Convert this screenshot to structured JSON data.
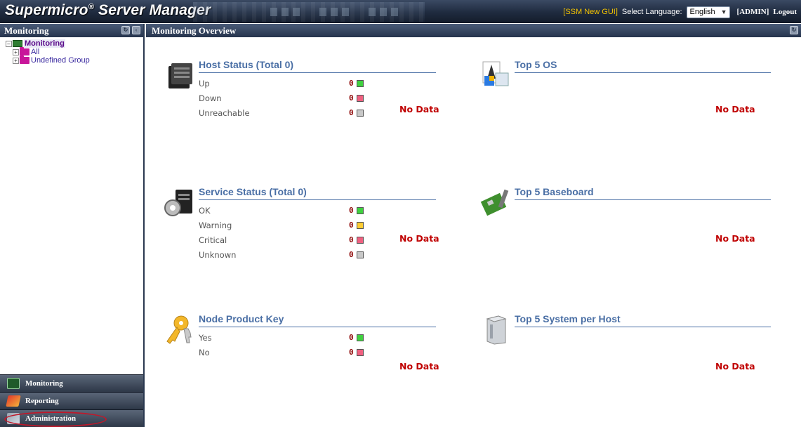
{
  "header": {
    "brand": "Supermicro",
    "brand_reg": "®",
    "brand_rest": " Server Manager",
    "ssm_new_gui": "[SSM New GUI]",
    "language_label": "Select Language:",
    "language_value": "English",
    "user": "[ADMIN]",
    "logout": "Logout"
  },
  "left_panel": {
    "title": "Monitoring",
    "tree": {
      "root": "Monitoring",
      "children": [
        "All",
        "Undefined Group"
      ]
    }
  },
  "bottom_nav": [
    "Monitoring",
    "Reporting",
    "Administration"
  ],
  "main": {
    "title": "Monitoring Overview",
    "host_status": {
      "title": "Host Status (Total 0)",
      "rows": [
        {
          "label": "Up",
          "count": "0",
          "color": "#3fd13f"
        },
        {
          "label": "Down",
          "count": "0",
          "color": "#f06080"
        },
        {
          "label": "Unreachable",
          "count": "0",
          "color": "#c8c8c8"
        }
      ],
      "no_data": "No Data"
    },
    "service_status": {
      "title": "Service Status (Total 0)",
      "rows": [
        {
          "label": "OK",
          "count": "0",
          "color": "#3fd13f"
        },
        {
          "label": "Warning",
          "count": "0",
          "color": "#ffcc33"
        },
        {
          "label": "Critical",
          "count": "0",
          "color": "#f06080"
        },
        {
          "label": "Unknown",
          "count": "0",
          "color": "#c8c8c8"
        }
      ],
      "no_data": "No Data"
    },
    "node_product_key": {
      "title": "Node Product Key",
      "rows": [
        {
          "label": "Yes",
          "count": "0",
          "color": "#3fd13f"
        },
        {
          "label": "No",
          "count": "0",
          "color": "#f06080"
        }
      ],
      "no_data": "No Data"
    },
    "top_os": {
      "title": "Top 5 OS",
      "no_data": "No Data"
    },
    "top_baseboard": {
      "title": "Top 5 Baseboard",
      "no_data": "No Data"
    },
    "top_system": {
      "title": "Top 5 System per Host",
      "no_data": "No Data"
    }
  }
}
